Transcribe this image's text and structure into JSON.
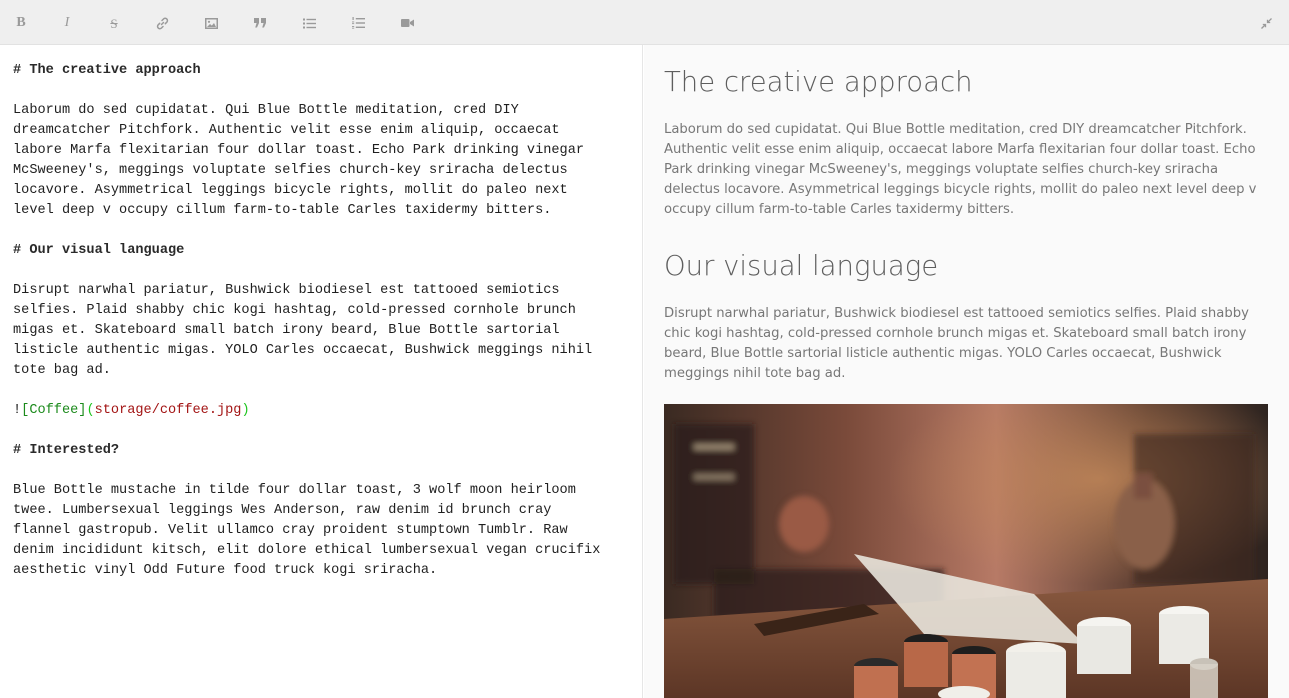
{
  "toolbar": {
    "buttons": [
      {
        "name": "bold-button",
        "icon": "bold-icon",
        "glyph": "B"
      },
      {
        "name": "italic-button",
        "icon": "italic-icon",
        "glyph": "I"
      },
      {
        "name": "strikethrough-button",
        "icon": "strikethrough-icon",
        "glyph": "S"
      },
      {
        "name": "link-button",
        "icon": "link-icon"
      },
      {
        "name": "image-button",
        "icon": "image-icon"
      },
      {
        "name": "quote-button",
        "icon": "quote-icon"
      },
      {
        "name": "unordered-list-button",
        "icon": "list-icon"
      },
      {
        "name": "ordered-list-button",
        "icon": "ordered-list-icon"
      },
      {
        "name": "video-button",
        "icon": "video-camera-icon"
      },
      {
        "name": "collapse-button",
        "icon": "collapse-icon"
      }
    ]
  },
  "editor": {
    "heading1": "# The creative approach",
    "para1": "Laborum do sed cupidatat. Qui Blue Bottle meditation, cred DIY\ndreamcatcher Pitchfork. Authentic velit esse enim aliquip, occaecat\nlabore Marfa flexitarian four dollar toast. Echo Park drinking vinegar\nMcSweeney's, meggings voluptate selfies church-key sriracha delectus\nlocavore. Asymmetrical leggings bicycle rights, mollit do paleo next\nlevel deep v occupy cillum farm-to-table Carles taxidermy bitters.",
    "heading2": "# Our visual language",
    "para2": "Disrupt narwhal pariatur, Bushwick biodiesel est tattooed semiotics\nselfies. Plaid shabby chic kogi hashtag, cold-pressed cornhole brunch\nmigas et. Skateboard small batch irony beard, Blue Bottle sartorial\nlisticle authentic migas. YOLO Carles occaecat, Bushwick meggings nihil\ntote bag ad.",
    "image_bang": "!",
    "image_alt": "[Coffee]",
    "image_paren_open": "(",
    "image_url": "storage/coffee.jpg",
    "image_paren_close": ")",
    "heading3": "# Interested?",
    "para3": "Blue Bottle mustache in tilde four dollar toast, 3 wolf moon heirloom\ntwee. Lumbersexual leggings Wes Anderson, raw denim id brunch cray\nflannel gastropub. Velit ullamco cray proident stumptown Tumblr. Raw\ndenim incididunt kitsch, elit dolore ethical lumbersexual vegan crucifix\naesthetic vinyl Odd Future food truck kogi sriracha."
  },
  "preview": {
    "heading1": "The creative approach",
    "para1": "Laborum do sed cupidatat. Qui Blue Bottle meditation, cred DIY dreamcatcher Pitchfork. Authentic velit esse enim aliquip, occaecat labore Marfa flexitarian four dollar toast. Echo Park drinking vinegar McSweeney's, meggings voluptate selfies church-key sriracha delectus locavore. Asymmetrical leggings bicycle rights, mollit do paleo next level deep v occupy cillum farm-to-table Carles taxidermy bitters.",
    "heading2": "Our visual language",
    "para2": "Disrupt narwhal pariatur, Bushwick biodiesel est tattooed semiotics selfies. Plaid shabby chic kogi hashtag, cold-pressed cornhole brunch migas et. Skateboard small batch irony beard, Blue Bottle sartorial listicle authentic migas. YOLO Carles occaecat, Bushwick meggings nihil tote bag ad.",
    "image_alt": "Coffee"
  },
  "colors": {
    "toolbar_bg": "#efefef",
    "icon": "#9a9a9a",
    "preview_bg": "#fafafa",
    "md_link_alt": "#1b8a1b",
    "md_link_url": "#a31515"
  }
}
